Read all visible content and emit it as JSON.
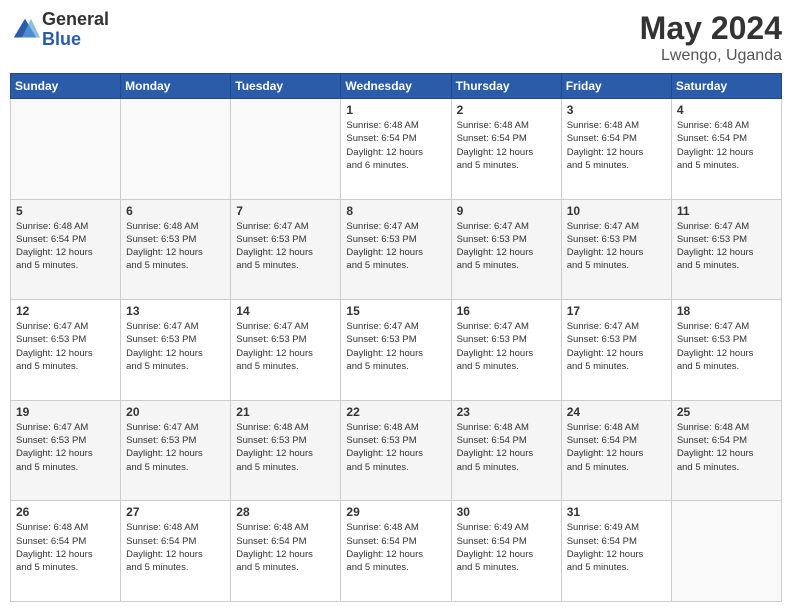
{
  "logo": {
    "general": "General",
    "blue": "Blue"
  },
  "title": "May 2024",
  "subtitle": "Lwengo, Uganda",
  "header_days": [
    "Sunday",
    "Monday",
    "Tuesday",
    "Wednesday",
    "Thursday",
    "Friday",
    "Saturday"
  ],
  "weeks": [
    [
      {
        "day": "",
        "info": ""
      },
      {
        "day": "",
        "info": ""
      },
      {
        "day": "",
        "info": ""
      },
      {
        "day": "1",
        "info": "Sunrise: 6:48 AM\nSunset: 6:54 PM\nDaylight: 12 hours\nand 6 minutes."
      },
      {
        "day": "2",
        "info": "Sunrise: 6:48 AM\nSunset: 6:54 PM\nDaylight: 12 hours\nand 5 minutes."
      },
      {
        "day": "3",
        "info": "Sunrise: 6:48 AM\nSunset: 6:54 PM\nDaylight: 12 hours\nand 5 minutes."
      },
      {
        "day": "4",
        "info": "Sunrise: 6:48 AM\nSunset: 6:54 PM\nDaylight: 12 hours\nand 5 minutes."
      }
    ],
    [
      {
        "day": "5",
        "info": "Sunrise: 6:48 AM\nSunset: 6:54 PM\nDaylight: 12 hours\nand 5 minutes."
      },
      {
        "day": "6",
        "info": "Sunrise: 6:48 AM\nSunset: 6:53 PM\nDaylight: 12 hours\nand 5 minutes."
      },
      {
        "day": "7",
        "info": "Sunrise: 6:47 AM\nSunset: 6:53 PM\nDaylight: 12 hours\nand 5 minutes."
      },
      {
        "day": "8",
        "info": "Sunrise: 6:47 AM\nSunset: 6:53 PM\nDaylight: 12 hours\nand 5 minutes."
      },
      {
        "day": "9",
        "info": "Sunrise: 6:47 AM\nSunset: 6:53 PM\nDaylight: 12 hours\nand 5 minutes."
      },
      {
        "day": "10",
        "info": "Sunrise: 6:47 AM\nSunset: 6:53 PM\nDaylight: 12 hours\nand 5 minutes."
      },
      {
        "day": "11",
        "info": "Sunrise: 6:47 AM\nSunset: 6:53 PM\nDaylight: 12 hours\nand 5 minutes."
      }
    ],
    [
      {
        "day": "12",
        "info": "Sunrise: 6:47 AM\nSunset: 6:53 PM\nDaylight: 12 hours\nand 5 minutes."
      },
      {
        "day": "13",
        "info": "Sunrise: 6:47 AM\nSunset: 6:53 PM\nDaylight: 12 hours\nand 5 minutes."
      },
      {
        "day": "14",
        "info": "Sunrise: 6:47 AM\nSunset: 6:53 PM\nDaylight: 12 hours\nand 5 minutes."
      },
      {
        "day": "15",
        "info": "Sunrise: 6:47 AM\nSunset: 6:53 PM\nDaylight: 12 hours\nand 5 minutes."
      },
      {
        "day": "16",
        "info": "Sunrise: 6:47 AM\nSunset: 6:53 PM\nDaylight: 12 hours\nand 5 minutes."
      },
      {
        "day": "17",
        "info": "Sunrise: 6:47 AM\nSunset: 6:53 PM\nDaylight: 12 hours\nand 5 minutes."
      },
      {
        "day": "18",
        "info": "Sunrise: 6:47 AM\nSunset: 6:53 PM\nDaylight: 12 hours\nand 5 minutes."
      }
    ],
    [
      {
        "day": "19",
        "info": "Sunrise: 6:47 AM\nSunset: 6:53 PM\nDaylight: 12 hours\nand 5 minutes."
      },
      {
        "day": "20",
        "info": "Sunrise: 6:47 AM\nSunset: 6:53 PM\nDaylight: 12 hours\nand 5 minutes."
      },
      {
        "day": "21",
        "info": "Sunrise: 6:48 AM\nSunset: 6:53 PM\nDaylight: 12 hours\nand 5 minutes."
      },
      {
        "day": "22",
        "info": "Sunrise: 6:48 AM\nSunset: 6:53 PM\nDaylight: 12 hours\nand 5 minutes."
      },
      {
        "day": "23",
        "info": "Sunrise: 6:48 AM\nSunset: 6:54 PM\nDaylight: 12 hours\nand 5 minutes."
      },
      {
        "day": "24",
        "info": "Sunrise: 6:48 AM\nSunset: 6:54 PM\nDaylight: 12 hours\nand 5 minutes."
      },
      {
        "day": "25",
        "info": "Sunrise: 6:48 AM\nSunset: 6:54 PM\nDaylight: 12 hours\nand 5 minutes."
      }
    ],
    [
      {
        "day": "26",
        "info": "Sunrise: 6:48 AM\nSunset: 6:54 PM\nDaylight: 12 hours\nand 5 minutes."
      },
      {
        "day": "27",
        "info": "Sunrise: 6:48 AM\nSunset: 6:54 PM\nDaylight: 12 hours\nand 5 minutes."
      },
      {
        "day": "28",
        "info": "Sunrise: 6:48 AM\nSunset: 6:54 PM\nDaylight: 12 hours\nand 5 minutes."
      },
      {
        "day": "29",
        "info": "Sunrise: 6:48 AM\nSunset: 6:54 PM\nDaylight: 12 hours\nand 5 minutes."
      },
      {
        "day": "30",
        "info": "Sunrise: 6:49 AM\nSunset: 6:54 PM\nDaylight: 12 hours\nand 5 minutes."
      },
      {
        "day": "31",
        "info": "Sunrise: 6:49 AM\nSunset: 6:54 PM\nDaylight: 12 hours\nand 5 minutes."
      },
      {
        "day": "",
        "info": ""
      }
    ]
  ]
}
